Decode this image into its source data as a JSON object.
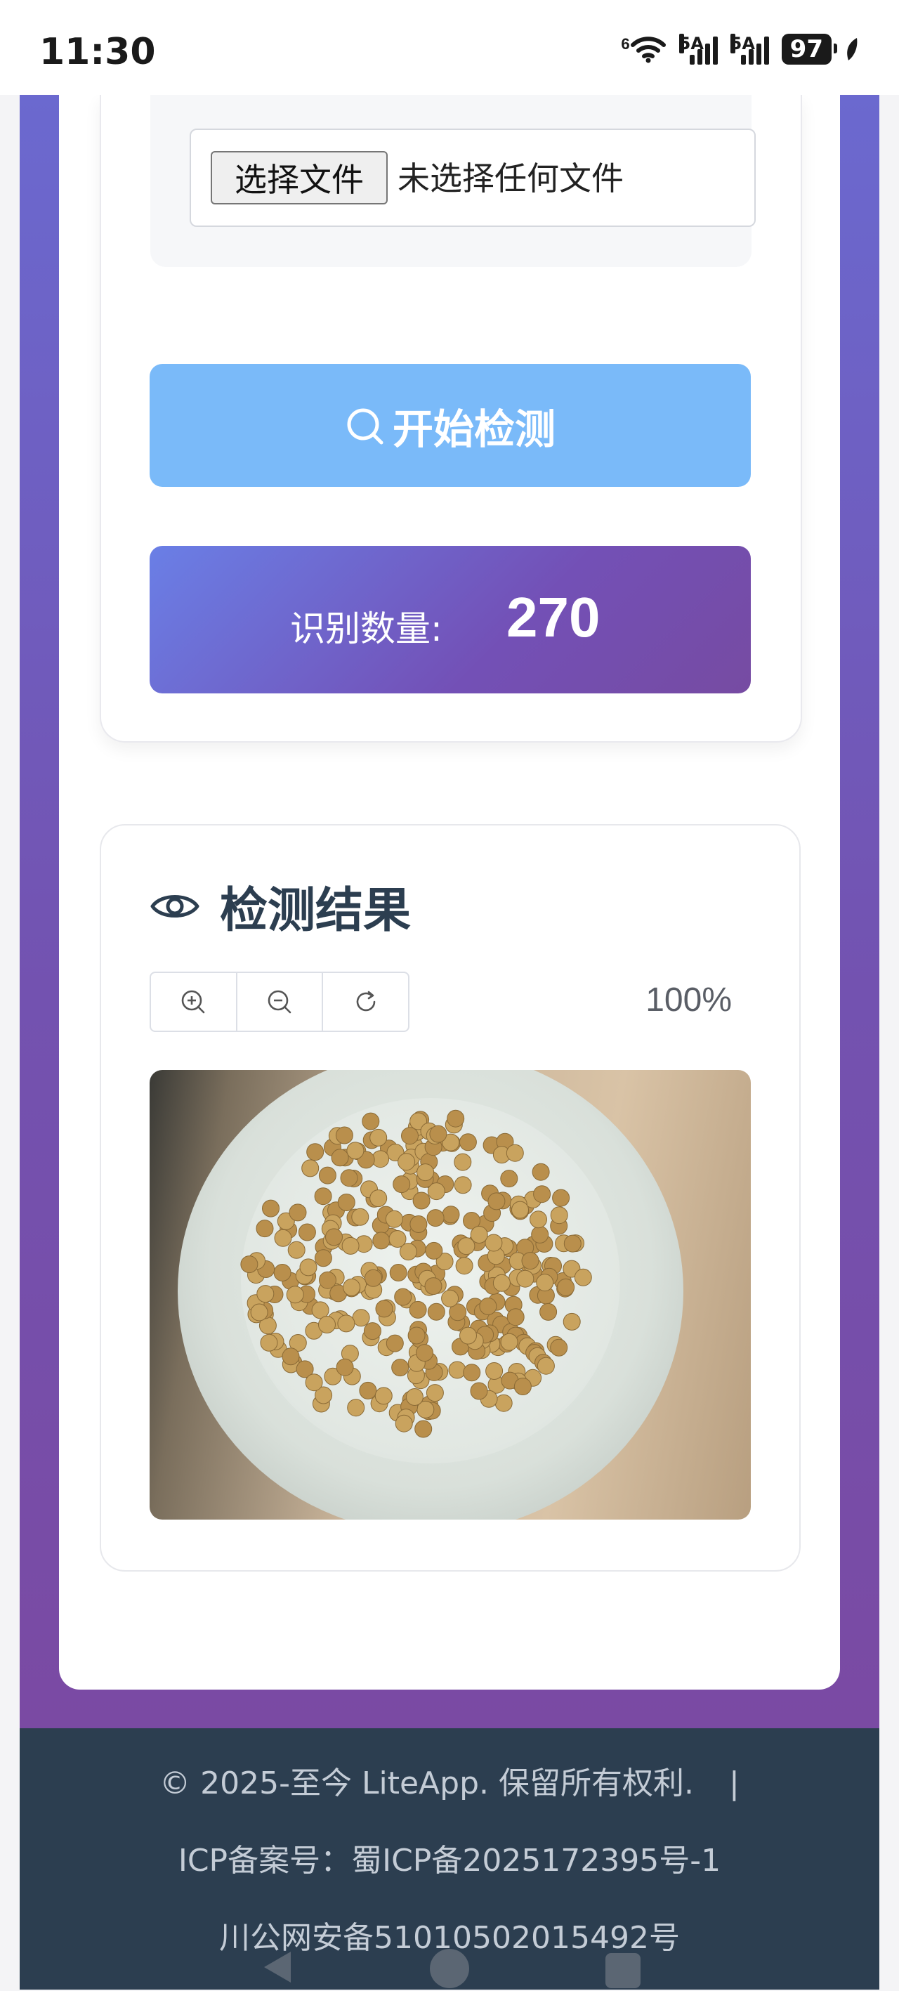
{
  "status_bar": {
    "time": "11:30",
    "wifi_label": "6",
    "network_1": "5A",
    "network_2": "5A",
    "battery": "97"
  },
  "upload": {
    "file_button_label": "选择文件",
    "file_status": "未选择任何文件"
  },
  "detect_button": {
    "label": "开始检测",
    "icon": "search-icon",
    "color": "#7abaf9"
  },
  "count": {
    "label": "识别数量:",
    "value": "270"
  },
  "result": {
    "title": "检测结果",
    "title_icon": "eye-icon",
    "toolbar": [
      "zoom-in-icon",
      "zoom-out-icon",
      "rotate-icon"
    ],
    "zoom_level": "100%",
    "image_subject": "soybeans-on-plate"
  },
  "footer": {
    "copyright": "© 2025-至今 LiteApp. 保留所有权利.",
    "separator": "|",
    "icp": "ICP备案号：蜀ICP备2025172395号-1",
    "police": "川公网安备51010502015492号"
  },
  "colors": {
    "gradient_start": "#6a7fe6",
    "gradient_end": "#764ba2",
    "footer_bg": "#2c3e50",
    "title_text": "#2c3e50"
  }
}
